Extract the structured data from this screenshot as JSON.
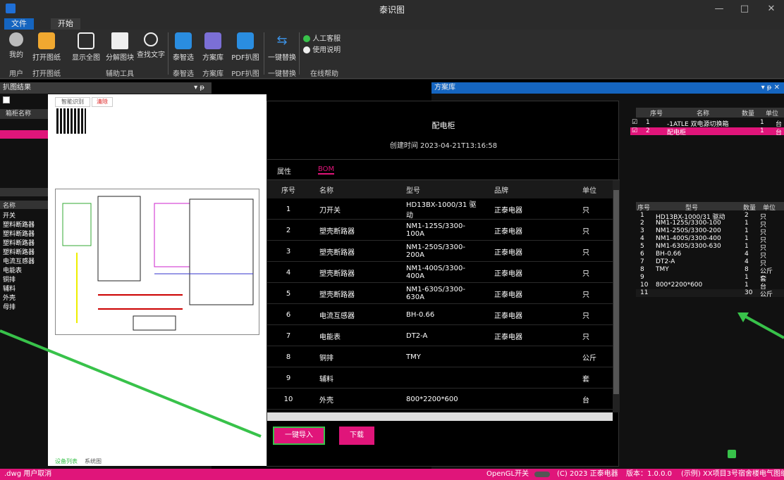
{
  "window": {
    "title": "泰识图",
    "min": "—",
    "max": "□",
    "close": "✕"
  },
  "menu": {
    "file": "文件",
    "start": "开始"
  },
  "ribbon": {
    "buttons": [
      {
        "label": "我的"
      },
      {
        "label": "打开图纸"
      },
      {
        "label": "显示全图"
      },
      {
        "label": "分解图块"
      },
      {
        "label": "查找文字"
      },
      {
        "label": "泰智选"
      },
      {
        "label": "方案库"
      },
      {
        "label": "PDF扒图"
      },
      {
        "label": "一键替换"
      }
    ],
    "help": {
      "service": "人工客服",
      "manual": "使用说明"
    },
    "groups": [
      "用户",
      "打开图纸",
      "辅助工具",
      "泰智选",
      "方案库",
      "PDF扒图",
      "一键替换",
      "在线帮助"
    ]
  },
  "left_panel": {
    "title": "扒图结果",
    "pin": "▾ ᵽ",
    "col_header": "箱柜名称",
    "col2_header": "名称",
    "rows": [
      "开关",
      "塑料断路器",
      "塑料断路器",
      "塑料断路器",
      "塑料断路器",
      "电流互感器",
      "电能表",
      "铜排",
      "辅料",
      "外壳",
      "母排"
    ]
  },
  "right_panel": {
    "title": "方案库",
    "pin": "▾ ᵽ ✕",
    "top_headers": [
      "序号",
      "名称",
      "数量",
      "单位"
    ],
    "top_rows": [
      {
        "no": "1",
        "name": "-1ATLE 双电源切换箱",
        "qty": "1",
        "unit": "台"
      },
      {
        "no": "2",
        "name": "配电柜",
        "qty": "1",
        "unit": "台"
      }
    ],
    "bottom_headers": [
      "序号",
      "型号",
      "数量",
      "单位"
    ],
    "bottom_rows": [
      {
        "no": "1",
        "model": "HD13BX-1000/31 驱动",
        "qty": "2",
        "unit": "只"
      },
      {
        "no": "2",
        "model": "NM1-125S/3300-100",
        "qty": "1",
        "unit": "只"
      },
      {
        "no": "3",
        "model": "NM1-250S/3300-200",
        "qty": "1",
        "unit": "只"
      },
      {
        "no": "4",
        "model": "NM1-400S/3300-400",
        "qty": "1",
        "unit": "只"
      },
      {
        "no": "5",
        "model": "NM1-630S/3300-630",
        "qty": "1",
        "unit": "只"
      },
      {
        "no": "6",
        "model": "BH-0.66",
        "qty": "4",
        "unit": "只"
      },
      {
        "no": "7",
        "model": "DT2-A",
        "qty": "4",
        "unit": "只"
      },
      {
        "no": "8",
        "model": "TMY",
        "qty": "8",
        "unit": "公斤"
      },
      {
        "no": "9",
        "model": "",
        "qty": "1",
        "unit": "套"
      },
      {
        "no": "10",
        "model": "800*2200*600",
        "qty": "1",
        "unit": "台"
      },
      {
        "no": "11",
        "model": "",
        "qty": "30",
        "unit": "公斤"
      }
    ]
  },
  "preview": {
    "tab1": "智能识别",
    "tab2": "清除",
    "bottom_tab1": "设备列表",
    "bottom_tab2": "系统图"
  },
  "modal": {
    "title": "配电柜",
    "created": "创建时间 2023-04-21T13:16:58",
    "tabs": [
      "属性",
      "BOM"
    ],
    "headers": [
      "序号",
      "名称",
      "型号",
      "品牌",
      "单位"
    ],
    "rows": [
      {
        "no": "1",
        "name": "刀开关",
        "model": "HD13BX-1000/31 驱动",
        "brand": "正泰电器",
        "unit": "只"
      },
      {
        "no": "2",
        "name": "塑壳断路器",
        "model": "NM1-125S/3300-100A",
        "brand": "正泰电器",
        "unit": "只"
      },
      {
        "no": "3",
        "name": "塑壳断路器",
        "model": "NM1-250S/3300-200A",
        "brand": "正泰电器",
        "unit": "只"
      },
      {
        "no": "4",
        "name": "塑壳断路器",
        "model": "NM1-400S/3300-400A",
        "brand": "正泰电器",
        "unit": "只"
      },
      {
        "no": "5",
        "name": "塑壳断路器",
        "model": "NM1-630S/3300-630A",
        "brand": "正泰电器",
        "unit": "只"
      },
      {
        "no": "6",
        "name": "电流互感器",
        "model": "BH-0.66",
        "brand": "正泰电器",
        "unit": "只"
      },
      {
        "no": "7",
        "name": "电能表",
        "model": "DT2-A",
        "brand": "正泰电器",
        "unit": "只"
      },
      {
        "no": "8",
        "name": "铜排",
        "model": "TMY",
        "brand": "",
        "unit": "公斤"
      },
      {
        "no": "9",
        "name": "辅料",
        "model": "",
        "brand": "",
        "unit": "套"
      },
      {
        "no": "10",
        "name": "外壳",
        "model": "800*2200*600",
        "brand": "",
        "unit": "台"
      }
    ],
    "import_button": "一键导入",
    "download_button": "下载"
  },
  "status": {
    "left": ".dwg 用户取消",
    "opengl": "OpenGL开关",
    "copyright": "(C) 2023 正泰电器",
    "version": "版本：1.0.0.0",
    "project": "(示例) XX项目3号宿舍楼电气图纸"
  },
  "colors": {
    "accent": "#e0157a",
    "blue": "#1565c0",
    "green": "#38c24a"
  }
}
